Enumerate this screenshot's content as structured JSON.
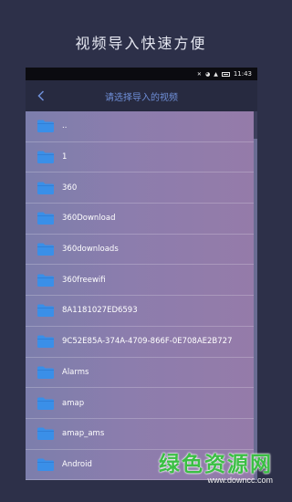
{
  "headline": "视频导入快速方便",
  "status_bar": {
    "time": "11:43"
  },
  "titlebar": {
    "title": "请选择导入的视频"
  },
  "files": [
    {
      "name": ".."
    },
    {
      "name": "1"
    },
    {
      "name": "360"
    },
    {
      "name": "360Download"
    },
    {
      "name": "360downloads"
    },
    {
      "name": "360freewifi"
    },
    {
      "name": "8A1181027ED6593"
    },
    {
      "name": "9C52E85A-374A-4709-866F-0E708AE2B727"
    },
    {
      "name": "Alarms"
    },
    {
      "name": "amap"
    },
    {
      "name": "amap_ams"
    },
    {
      "name": "Android"
    }
  ],
  "watermark": {
    "title": "绿色资源网",
    "url": "www.downcc.com"
  },
  "colors": {
    "background": "#2d3049",
    "title_text": "#6f8fd8",
    "folder_icon": "#3a8fe8",
    "watermark_green": "#3bbf44"
  }
}
